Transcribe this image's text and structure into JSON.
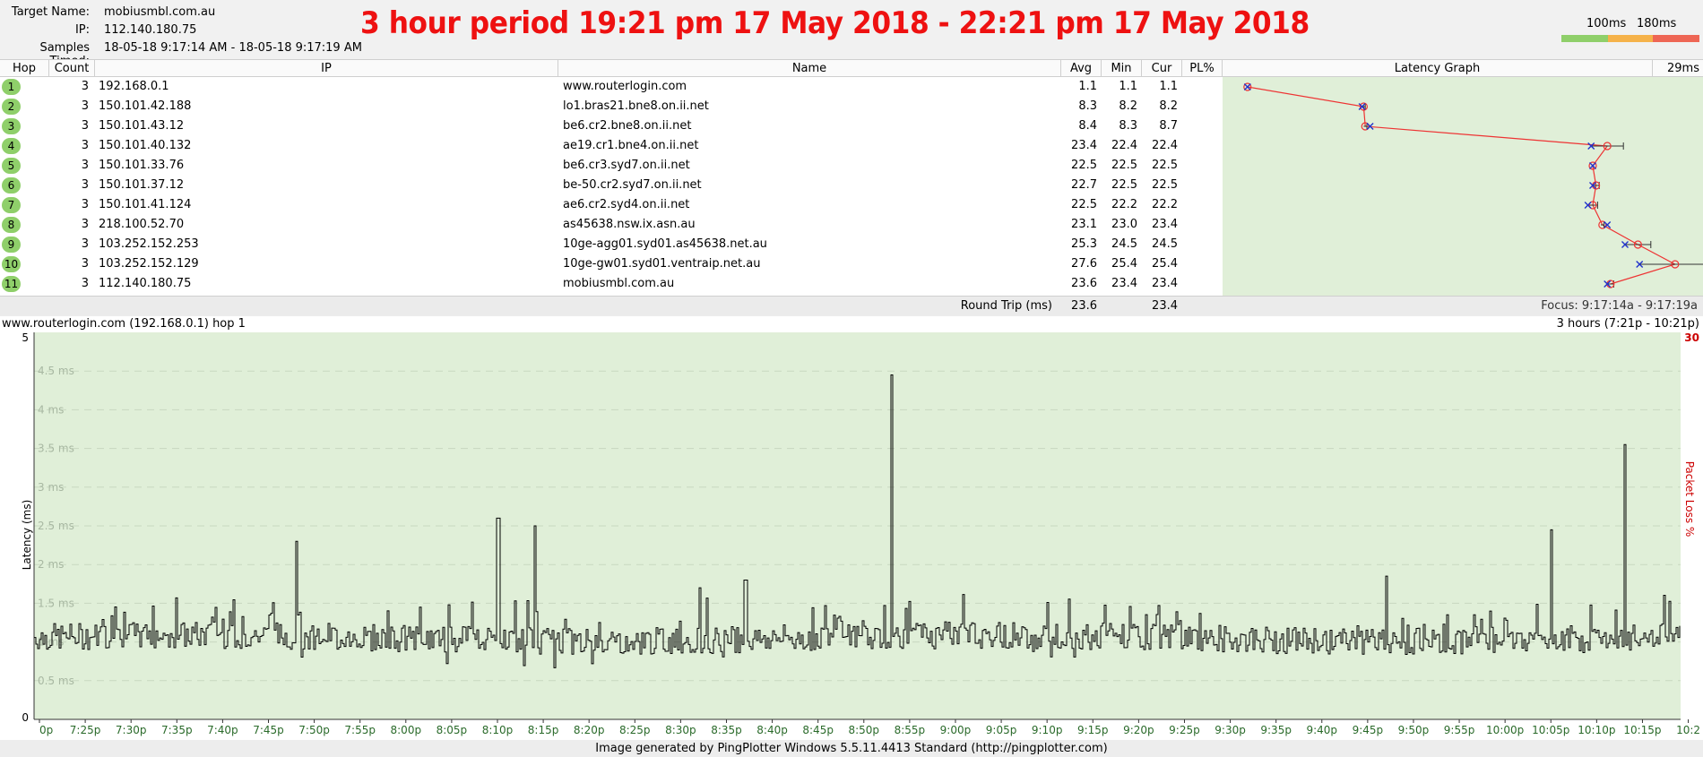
{
  "header": {
    "target_name_label": "Target Name:",
    "target_name": "mobiusmbl.com.au",
    "ip_label": "IP:",
    "ip": "112.140.180.75",
    "samples_label": "Samples Timed:",
    "samples": "18-05-18 9:17:14 AM - 18-05-18 9:17:19 AM",
    "banner": "3 hour period 19:21 pm 17 May 2018 - 22:21 pm 17 May 2018",
    "threshold_1": "100ms",
    "threshold_2": "180ms",
    "scale_colors": [
      "#8fcf6a",
      "#f5b24a",
      "#ee6655"
    ]
  },
  "table": {
    "columns": [
      "Hop",
      "Count",
      "IP",
      "Name",
      "Avg",
      "Min",
      "Cur",
      "PL%",
      "Latency Graph"
    ],
    "latency_scale_max": "29ms",
    "rows": [
      {
        "hop": "1",
        "count": "3",
        "ip": "192.168.0.1",
        "name": "www.routerlogin.com",
        "avg": "1.1",
        "min": "1.1",
        "cur": "1.1",
        "pl": ""
      },
      {
        "hop": "2",
        "count": "3",
        "ip": "150.101.42.188",
        "name": "lo1.bras21.bne8.on.ii.net",
        "avg": "8.3",
        "min": "8.2",
        "cur": "8.2",
        "pl": ""
      },
      {
        "hop": "3",
        "count": "3",
        "ip": "150.101.43.12",
        "name": "be6.cr2.bne8.on.ii.net",
        "avg": "8.4",
        "min": "8.3",
        "cur": "8.7",
        "pl": ""
      },
      {
        "hop": "4",
        "count": "3",
        "ip": "150.101.40.132",
        "name": "ae19.cr1.bne4.on.ii.net",
        "avg": "23.4",
        "min": "22.4",
        "cur": "22.4",
        "pl": ""
      },
      {
        "hop": "5",
        "count": "3",
        "ip": "150.101.33.76",
        "name": "be6.cr3.syd7.on.ii.net",
        "avg": "22.5",
        "min": "22.5",
        "cur": "22.5",
        "pl": ""
      },
      {
        "hop": "6",
        "count": "3",
        "ip": "150.101.37.12",
        "name": "be-50.cr2.syd7.on.ii.net",
        "avg": "22.7",
        "min": "22.5",
        "cur": "22.5",
        "pl": ""
      },
      {
        "hop": "7",
        "count": "3",
        "ip": "150.101.41.124",
        "name": "ae6.cr2.syd4.on.ii.net",
        "avg": "22.5",
        "min": "22.2",
        "cur": "22.2",
        "pl": ""
      },
      {
        "hop": "8",
        "count": "3",
        "ip": "218.100.52.70",
        "name": "as45638.nsw.ix.asn.au",
        "avg": "23.1",
        "min": "23.0",
        "cur": "23.4",
        "pl": ""
      },
      {
        "hop": "9",
        "count": "3",
        "ip": "103.252.152.253",
        "name": "10ge-agg01.syd01.as45638.net.au",
        "avg": "25.3",
        "min": "24.5",
        "cur": "24.5",
        "pl": ""
      },
      {
        "hop": "10",
        "count": "3",
        "ip": "103.252.152.129",
        "name": "10ge-gw01.syd01.ventraip.net.au",
        "avg": "27.6",
        "min": "25.4",
        "cur": "25.4",
        "pl": ""
      },
      {
        "hop": "11",
        "count": "3",
        "ip": "112.140.180.75",
        "name": "mobiusmbl.com.au",
        "avg": "23.6",
        "min": "23.4",
        "cur": "23.4",
        "pl": ""
      }
    ],
    "round_trip_label": "Round Trip (ms)",
    "round_trip_avg": "23.6",
    "round_trip_cur": "23.4",
    "focus": "Focus: 9:17:14a - 9:17:19a"
  },
  "history": {
    "host_label": "www.routerlogin.com (192.168.0.1) hop 1",
    "period": "3 hours (7:21p - 10:21p)",
    "packet_loss_max": "30"
  },
  "chart_data": {
    "type": "line",
    "ylabel": "Latency (ms)",
    "y2label": "Packet Loss %",
    "ylim": [
      0,
      5
    ],
    "y_axis_ends": [
      "5",
      "0"
    ],
    "y_ticks": [
      "4.5 ms",
      "4 ms",
      "3.5 ms",
      "3 ms",
      "2.5 ms",
      "2 ms",
      "1.5 ms",
      "1 ms",
      "0.5 ms"
    ],
    "x_ticks": [
      "0p",
      "7:25p",
      "7:30p",
      "7:35p",
      "7:40p",
      "7:45p",
      "7:50p",
      "7:55p",
      "8:00p",
      "8:05p",
      "8:10p",
      "8:15p",
      "8:20p",
      "8:25p",
      "8:30p",
      "8:35p",
      "8:40p",
      "8:45p",
      "8:50p",
      "8:55p",
      "9:00p",
      "9:05p",
      "9:10p",
      "9:15p",
      "9:20p",
      "9:25p",
      "9:30p",
      "9:35p",
      "9:40p",
      "9:45p",
      "9:50p",
      "9:55p",
      "10:00p",
      "10:05p",
      "10:10p",
      "10:15p",
      "10:2"
    ],
    "baseline_ms": 1.05,
    "spikes": [
      {
        "t": "7:48p",
        "value": 2.3
      },
      {
        "t": "8:10p",
        "value": 2.6
      },
      {
        "t": "8:14p",
        "value": 2.5
      },
      {
        "t": "8:32p",
        "value": 1.7
      },
      {
        "t": "8:37p",
        "value": 1.8
      },
      {
        "t": "8:53p",
        "value": 4.45
      },
      {
        "t": "9:47p",
        "value": 1.85
      },
      {
        "t": "10:05p",
        "value": 2.45
      },
      {
        "t": "10:13p",
        "value": 3.55
      }
    ],
    "grid": true,
    "line_color": "#000000",
    "plot_background": "#e0efd8",
    "y2_color": "#cc0000"
  },
  "footer": {
    "text": "Image generated by PingPlotter Windows 5.5.11.4413 Standard (http://pingplotter.com)"
  }
}
